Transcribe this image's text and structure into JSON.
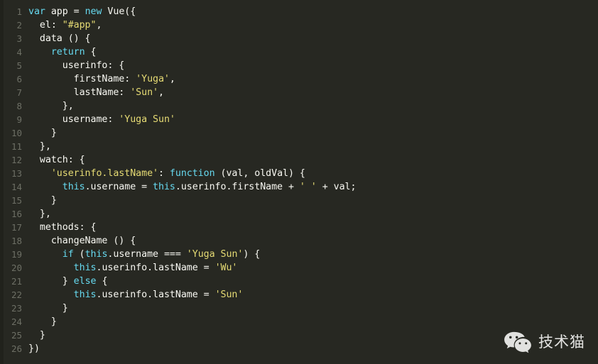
{
  "editor": {
    "background": "#272822",
    "gutter_color": "#6d6f65",
    "text_color": "#f8f8f2",
    "keyword_color": "#66d9ef",
    "string_color": "#e6db74",
    "line_count": 26,
    "lines": [
      {
        "number": "1",
        "tokens": [
          {
            "t": "var",
            "c": "kw"
          },
          {
            "t": " app = ",
            "c": "txt"
          },
          {
            "t": "new",
            "c": "kw"
          },
          {
            "t": " Vue({",
            "c": "txt"
          }
        ]
      },
      {
        "number": "2",
        "tokens": [
          {
            "t": "  el: ",
            "c": "txt"
          },
          {
            "t": "\"#app\"",
            "c": "str"
          },
          {
            "t": ",",
            "c": "txt"
          }
        ]
      },
      {
        "number": "3",
        "tokens": [
          {
            "t": "  data () {",
            "c": "txt"
          }
        ]
      },
      {
        "number": "4",
        "tokens": [
          {
            "t": "    ",
            "c": "txt"
          },
          {
            "t": "return",
            "c": "kw"
          },
          {
            "t": " {",
            "c": "txt"
          }
        ]
      },
      {
        "number": "5",
        "tokens": [
          {
            "t": "      userinfo: {",
            "c": "txt"
          }
        ]
      },
      {
        "number": "6",
        "tokens": [
          {
            "t": "        firstName: ",
            "c": "txt"
          },
          {
            "t": "'Yuga'",
            "c": "str"
          },
          {
            "t": ",",
            "c": "txt"
          }
        ]
      },
      {
        "number": "7",
        "tokens": [
          {
            "t": "        lastName: ",
            "c": "txt"
          },
          {
            "t": "'Sun'",
            "c": "str"
          },
          {
            "t": ",",
            "c": "txt"
          }
        ]
      },
      {
        "number": "8",
        "tokens": [
          {
            "t": "      },",
            "c": "txt"
          }
        ]
      },
      {
        "number": "9",
        "tokens": [
          {
            "t": "      username: ",
            "c": "txt"
          },
          {
            "t": "'Yuga Sun'",
            "c": "str"
          }
        ]
      },
      {
        "number": "10",
        "tokens": [
          {
            "t": "    }",
            "c": "txt"
          }
        ]
      },
      {
        "number": "11",
        "tokens": [
          {
            "t": "  },",
            "c": "txt"
          }
        ]
      },
      {
        "number": "12",
        "tokens": [
          {
            "t": "  watch: {",
            "c": "txt"
          }
        ]
      },
      {
        "number": "13",
        "tokens": [
          {
            "t": "    ",
            "c": "txt"
          },
          {
            "t": "'userinfo.lastName'",
            "c": "str"
          },
          {
            "t": ": ",
            "c": "txt"
          },
          {
            "t": "function",
            "c": "kw"
          },
          {
            "t": " (val, oldVal) {",
            "c": "txt"
          }
        ]
      },
      {
        "number": "14",
        "tokens": [
          {
            "t": "      ",
            "c": "txt"
          },
          {
            "t": "this",
            "c": "kw"
          },
          {
            "t": ".username = ",
            "c": "txt"
          },
          {
            "t": "this",
            "c": "kw"
          },
          {
            "t": ".userinfo.firstName + ",
            "c": "txt"
          },
          {
            "t": "' '",
            "c": "str"
          },
          {
            "t": " + val;",
            "c": "txt"
          }
        ]
      },
      {
        "number": "15",
        "tokens": [
          {
            "t": "    }",
            "c": "txt"
          }
        ]
      },
      {
        "number": "16",
        "tokens": [
          {
            "t": "  },",
            "c": "txt"
          }
        ]
      },
      {
        "number": "17",
        "tokens": [
          {
            "t": "  methods: {",
            "c": "txt"
          }
        ]
      },
      {
        "number": "18",
        "tokens": [
          {
            "t": "    changeName () {",
            "c": "txt"
          }
        ]
      },
      {
        "number": "19",
        "tokens": [
          {
            "t": "      ",
            "c": "txt"
          },
          {
            "t": "if",
            "c": "kw"
          },
          {
            "t": " (",
            "c": "txt"
          },
          {
            "t": "this",
            "c": "kw"
          },
          {
            "t": ".username === ",
            "c": "txt"
          },
          {
            "t": "'Yuga Sun'",
            "c": "str"
          },
          {
            "t": ") {",
            "c": "txt"
          }
        ]
      },
      {
        "number": "20",
        "tokens": [
          {
            "t": "        ",
            "c": "txt"
          },
          {
            "t": "this",
            "c": "kw"
          },
          {
            "t": ".userinfo.lastName = ",
            "c": "txt"
          },
          {
            "t": "'Wu'",
            "c": "str"
          }
        ]
      },
      {
        "number": "21",
        "tokens": [
          {
            "t": "      } ",
            "c": "txt"
          },
          {
            "t": "else",
            "c": "kw"
          },
          {
            "t": " {",
            "c": "txt"
          }
        ]
      },
      {
        "number": "22",
        "tokens": [
          {
            "t": "        ",
            "c": "txt"
          },
          {
            "t": "this",
            "c": "kw"
          },
          {
            "t": ".userinfo.lastName = ",
            "c": "txt"
          },
          {
            "t": "'Sun'",
            "c": "str"
          }
        ]
      },
      {
        "number": "23",
        "tokens": [
          {
            "t": "      }",
            "c": "txt"
          }
        ]
      },
      {
        "number": "24",
        "tokens": [
          {
            "t": "    }",
            "c": "txt"
          }
        ]
      },
      {
        "number": "25",
        "tokens": [
          {
            "t": "  }",
            "c": "txt"
          }
        ]
      },
      {
        "number": "26",
        "tokens": [
          {
            "t": "})",
            "c": "txt"
          }
        ]
      }
    ]
  },
  "watermark": {
    "icon": "wechat-logo-icon",
    "label": "技术猫",
    "color": "#f2f2f0"
  }
}
